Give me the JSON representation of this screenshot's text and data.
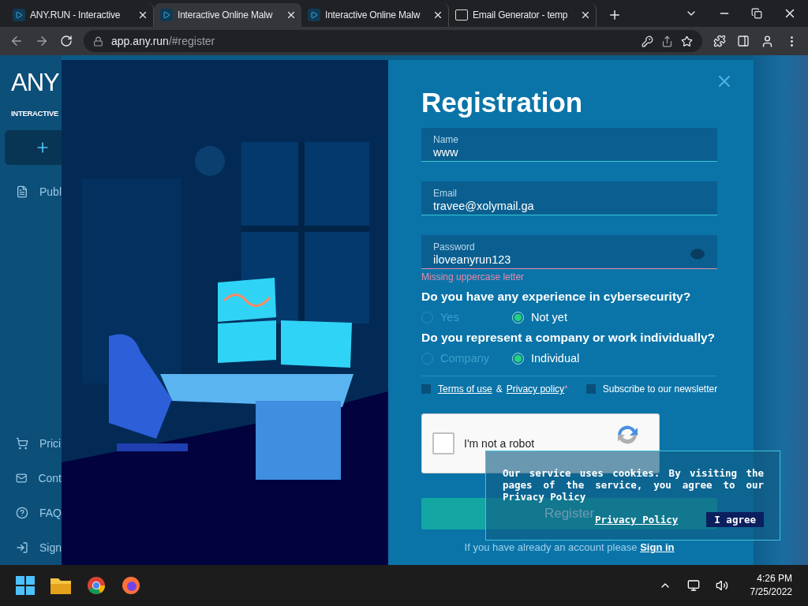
{
  "browser": {
    "tabs": [
      {
        "title": "ANY.RUN - Interactive",
        "kind": "site",
        "selected": false
      },
      {
        "title": "Interactive Online Malw",
        "kind": "site",
        "selected": true
      },
      {
        "title": "Interactive Online Malw",
        "kind": "site",
        "selected": false
      },
      {
        "title": "Email Generator - temp",
        "kind": "mail",
        "selected": false
      }
    ],
    "address": {
      "host": "app.any.run",
      "path": "/#register"
    }
  },
  "sidebar": {
    "logo": "ANY",
    "tagline": "INTERACTIVE",
    "nav_top": [
      {
        "label": "Publ"
      }
    ],
    "nav_bottom": [
      {
        "label": "Prici"
      },
      {
        "label": "Cont"
      },
      {
        "label": "FAQ"
      },
      {
        "label": "Sign"
      }
    ]
  },
  "modal": {
    "title": "Registration",
    "fields": [
      {
        "kind": "text",
        "label": "Name",
        "value": "www"
      },
      {
        "kind": "text",
        "label": "Email",
        "value": "travee@xolymail.ga"
      },
      {
        "kind": "password",
        "label": "Password",
        "value": "iloveanyrun123",
        "error": "Missing uppercase letter"
      }
    ],
    "questions": [
      {
        "text": "Do you have any experience in cybersecurity?",
        "options": [
          {
            "label": "Yes",
            "selected": false
          },
          {
            "label": "Not yet",
            "selected": true
          }
        ]
      },
      {
        "text": "Do you represent a company or work individually?",
        "options": [
          {
            "label": "Company",
            "selected": false
          },
          {
            "label": "Individual",
            "selected": true
          }
        ]
      }
    ],
    "terms": {
      "terms_link": "Terms of use",
      "joiner": "&",
      "privacy_link": "Privacy policy",
      "required_mark": "*",
      "checked": false
    },
    "newsletter": {
      "label": "Subscribe to our newsletter",
      "checked": false
    },
    "captcha": {
      "label": "I'm not a robot",
      "checked": false
    },
    "register_button": "Register",
    "signin_prompt": "If you have already an account please",
    "signin_link": "Sign in"
  },
  "cookie_banner": {
    "text": "Our service uses cookies. By visiting the pages of the service, you agree to our Privacy Policy",
    "privacy_link": "Privacy Policy",
    "agree_button": "I agree"
  },
  "taskbar": {
    "time": "4:26 PM",
    "date": "7/25/2022"
  }
}
